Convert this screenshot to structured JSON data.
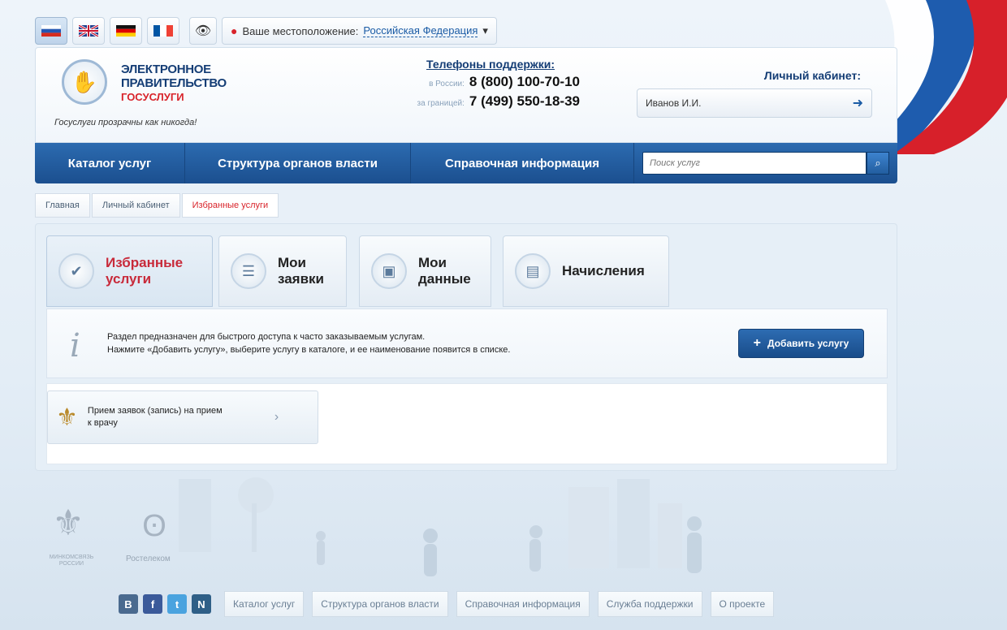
{
  "languages": [
    {
      "name": "ru-flag-icon"
    },
    {
      "name": "uk-flag-icon"
    },
    {
      "name": "de-flag-icon"
    },
    {
      "name": "fr-flag-icon"
    }
  ],
  "location": {
    "label": "Ваше местоположение:",
    "value": "Российская Федерация"
  },
  "logo": {
    "line1": "ЭЛЕКТРОННОЕ",
    "line2": "ПРАВИТЕЛЬСТВО",
    "line3": "ГОСУСЛУГИ",
    "tagline": "Госуслуги прозрачны как никогда!"
  },
  "support": {
    "title": "Телефоны поддержки:",
    "russia_label": "в России:",
    "russia_phone": "8 (800) 100-70-10",
    "abroad_label": "за границей:",
    "abroad_phone": "7 (499) 550-18-39"
  },
  "cabinet": {
    "title": "Личный кабинет:",
    "user": "Иванов И.И."
  },
  "nav": {
    "items": [
      "Каталог услуг",
      "Структура органов власти",
      "Справочная информация"
    ],
    "search_placeholder": "Поиск услуг"
  },
  "breadcrumb": [
    "Главная",
    "Личный кабинет",
    "Избранные услуги"
  ],
  "tabs": [
    {
      "line1": "Избранные",
      "line2": "услуги"
    },
    {
      "line1": "Мои",
      "line2": "заявки"
    },
    {
      "line1": "Мои",
      "line2": "данные"
    },
    {
      "line1": "Начисления",
      "line2": ""
    }
  ],
  "info": {
    "line1": "Раздел предназначен для быстрого доступа к часто заказываемым услугам.",
    "line2": "Нажмите «Добавить услугу», выберите услугу в каталоге, и ее наименование появится в списке.",
    "button": "Добавить услугу"
  },
  "services": [
    {
      "line1": "Прием заявок (запись) на прием",
      "line2": "к врачу"
    }
  ],
  "partners": {
    "ministry": "МИНКОМСВЯЗЬ РОССИИ",
    "rostelecom": "Ростелеком"
  },
  "footer": {
    "social": [
      "В",
      "f",
      "t",
      "N"
    ],
    "links": [
      "Каталог услуг",
      "Структура органов власти",
      "Справочная информация",
      "Служба поддержки",
      "О проекте"
    ]
  },
  "colors": {
    "brand_blue": "#1b4f8f",
    "accent_red": "#d8232a",
    "background": "#e3edf6"
  }
}
